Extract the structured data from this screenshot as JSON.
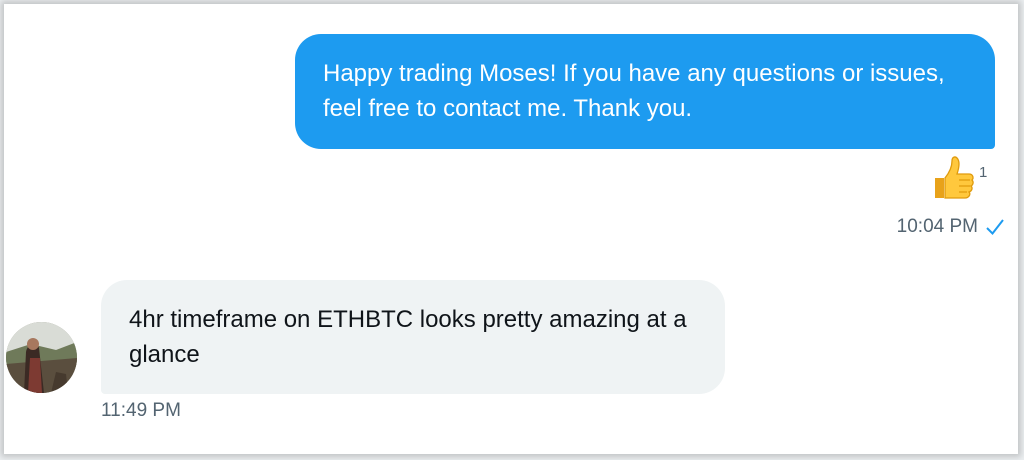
{
  "conversation": {
    "outgoing_message": {
      "text": "Happy trading Moses! If you have any questions or issues, feel free to contact me. Thank you.",
      "reaction": {
        "emoji": "👍",
        "icon": "thumbs-up-icon",
        "count": "1"
      },
      "timestamp": "10:04 PM",
      "status_icon": "read-check-icon"
    },
    "incoming_message": {
      "avatar_icon": "avatar",
      "text": "4hr timeframe on ETHBTC looks pretty amazing at a glance",
      "timestamp": "11:49 PM"
    }
  },
  "colors": {
    "outgoing_bubble": "#1d9bf0",
    "incoming_bubble": "#eff3f4",
    "meta_text": "#536471",
    "check": "#1d9bf0"
  }
}
